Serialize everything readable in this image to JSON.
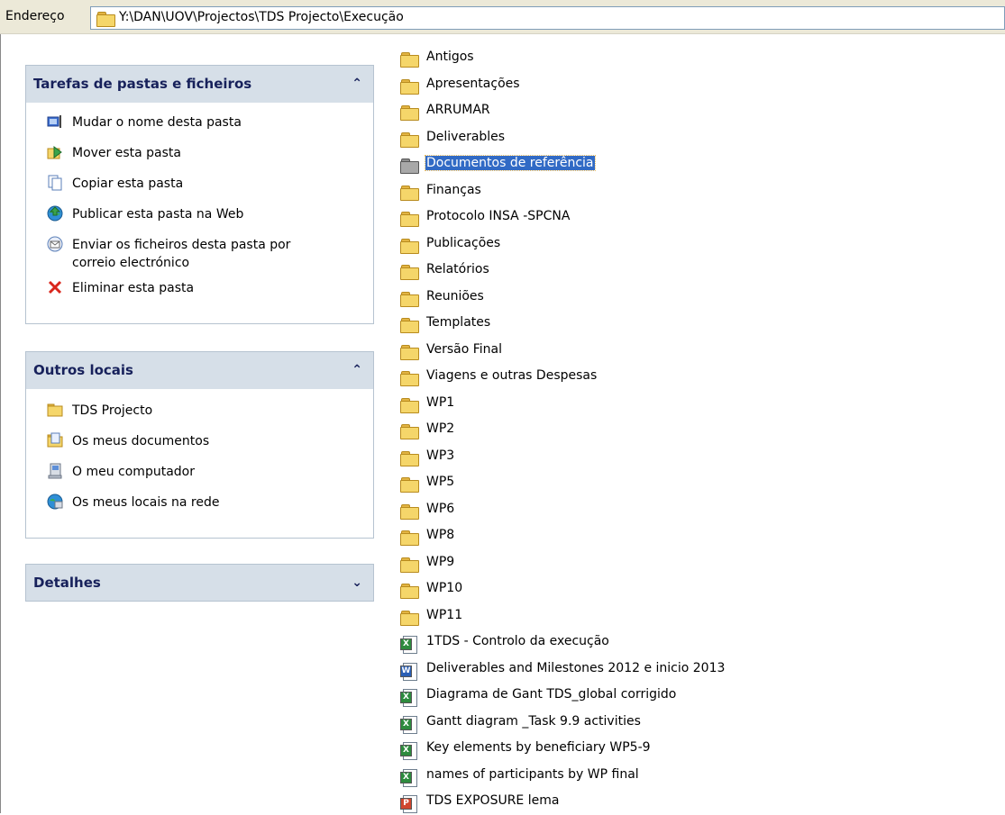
{
  "address_bar": {
    "label": "Endereço",
    "path": "Y:\\DAN\\UOV\\Projectos\\TDS Projecto\\Execução"
  },
  "task_pane": {
    "folder_tasks": {
      "title": "Tarefas de pastas e ficheiros",
      "items": [
        {
          "label": "Mudar o nome desta pasta",
          "icon": "rename-icon"
        },
        {
          "label": "Mover esta pasta",
          "icon": "move-icon"
        },
        {
          "label": "Copiar esta pasta",
          "icon": "copy-icon"
        },
        {
          "label": "Publicar esta pasta na Web",
          "icon": "publish-web-icon"
        },
        {
          "label": "Enviar os ficheiros desta pasta por",
          "label2": "correio electrónico",
          "icon": "email-icon"
        },
        {
          "label": "Eliminar esta pasta",
          "icon": "delete-icon"
        }
      ]
    },
    "other_places": {
      "title": "Outros locais",
      "items": [
        {
          "label": "TDS Projecto",
          "icon": "folder-icon"
        },
        {
          "label": "Os meus documentos",
          "icon": "my-documents-icon"
        },
        {
          "label": "O meu computador",
          "icon": "my-computer-icon"
        },
        {
          "label": "Os meus locais na rede",
          "icon": "network-places-icon"
        }
      ]
    },
    "details": {
      "title": "Detalhes"
    }
  },
  "files": [
    {
      "name": "Antigos",
      "type": "folder"
    },
    {
      "name": "Apresentações",
      "type": "folder"
    },
    {
      "name": "ARRUMAR",
      "type": "folder"
    },
    {
      "name": "Deliverables",
      "type": "folder"
    },
    {
      "name": "Documentos de referência",
      "type": "folder",
      "selected": true
    },
    {
      "name": "Finanças",
      "type": "folder"
    },
    {
      "name": "Protocolo INSA -SPCNA",
      "type": "folder"
    },
    {
      "name": "Publicações",
      "type": "folder"
    },
    {
      "name": "Relatórios",
      "type": "folder"
    },
    {
      "name": "Reuniões",
      "type": "folder"
    },
    {
      "name": "Templates",
      "type": "folder"
    },
    {
      "name": "Versão Final",
      "type": "folder"
    },
    {
      "name": "Viagens e outras Despesas",
      "type": "folder"
    },
    {
      "name": "WP1",
      "type": "folder"
    },
    {
      "name": "WP2",
      "type": "folder"
    },
    {
      "name": "WP3",
      "type": "folder"
    },
    {
      "name": "WP5",
      "type": "folder"
    },
    {
      "name": "WP6",
      "type": "folder"
    },
    {
      "name": "WP8",
      "type": "folder"
    },
    {
      "name": "WP9",
      "type": "folder"
    },
    {
      "name": "WP10",
      "type": "folder"
    },
    {
      "name": "WP11",
      "type": "folder"
    },
    {
      "name": "1TDS - Controlo da execução",
      "type": "excel"
    },
    {
      "name": "Deliverables and Milestones 2012 e inicio 2013",
      "type": "word"
    },
    {
      "name": "Diagrama de Gant  TDS_global corrigido",
      "type": "excel"
    },
    {
      "name": "Gantt diagram _Task 9.9 activities",
      "type": "excel"
    },
    {
      "name": "Key elements by beneficiary WP5-9",
      "type": "excel"
    },
    {
      "name": "names of participants by WP final",
      "type": "excel"
    },
    {
      "name": "TDS EXPOSURE lema",
      "type": "powerpoint"
    }
  ],
  "colors": {
    "selection": "#316ac5",
    "pane_header": "#d6dfe8",
    "pane_title": "#17215b"
  }
}
